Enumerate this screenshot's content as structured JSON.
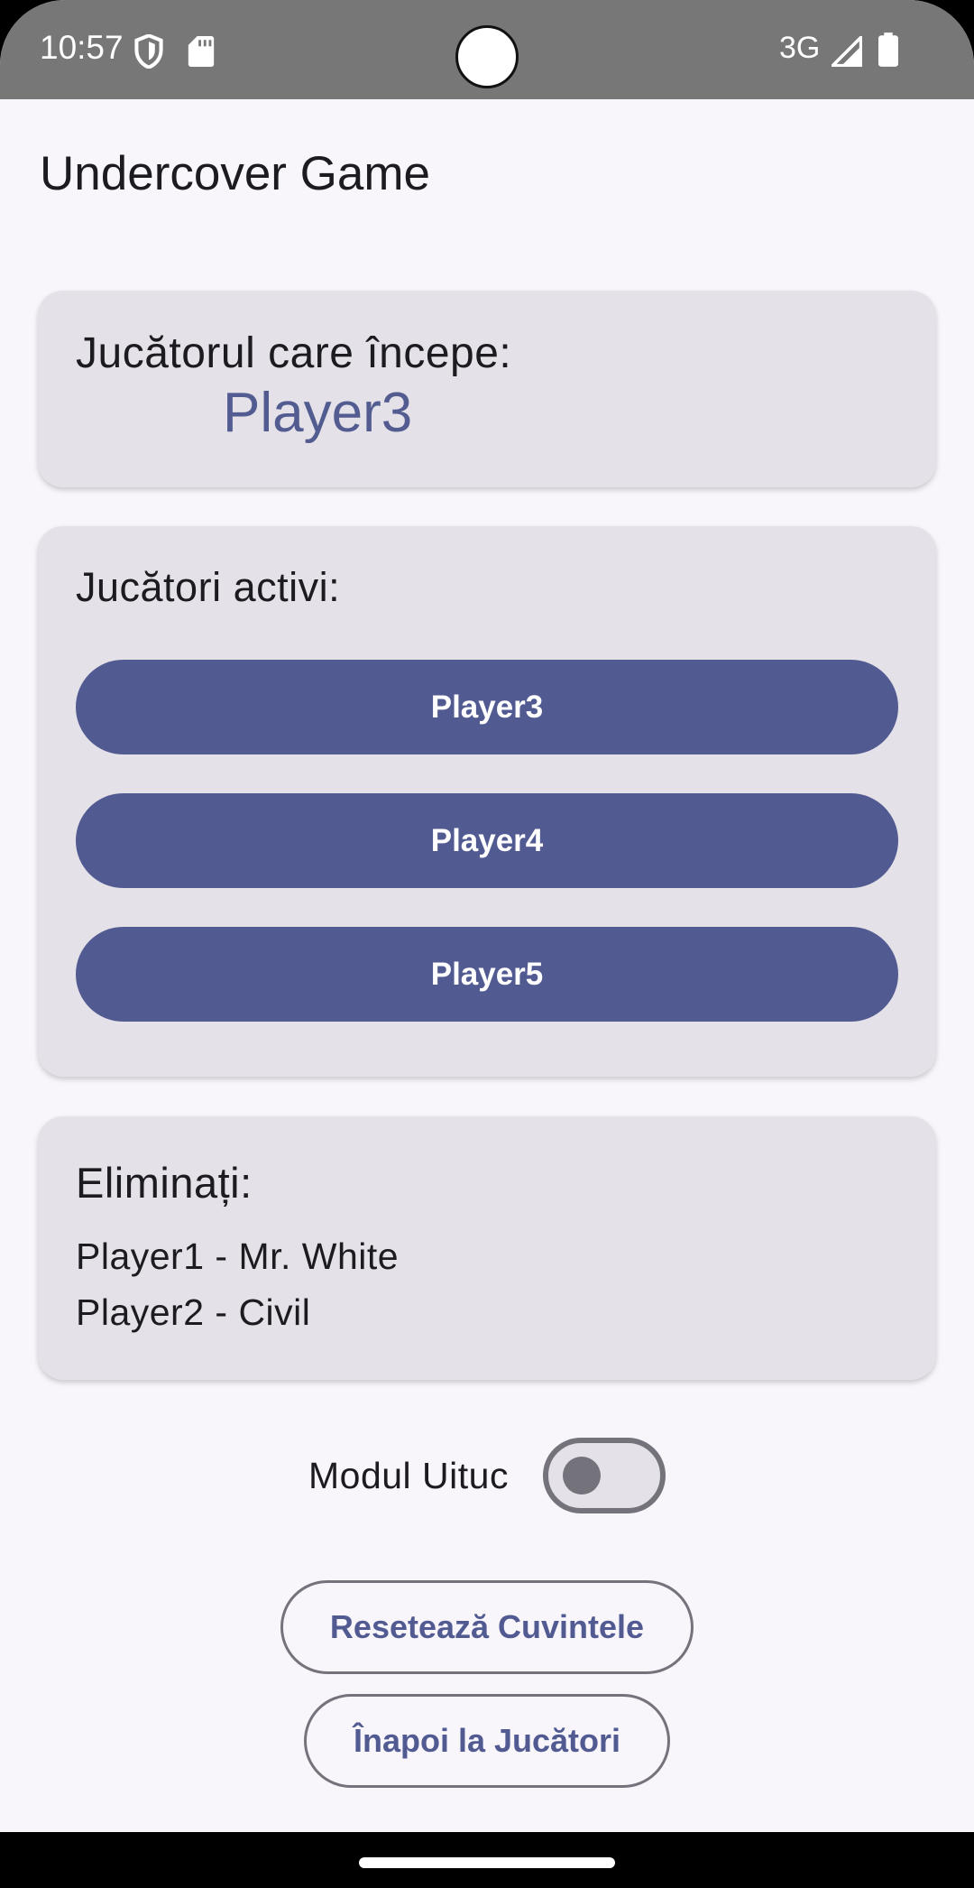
{
  "status_bar": {
    "time": "10:57",
    "network": "3G",
    "icons": [
      "shield-icon",
      "sd-card-icon",
      "cellular-signal-icon",
      "battery-icon"
    ]
  },
  "app": {
    "title": "Undercover Game"
  },
  "starting_player": {
    "label": "Jucătorul care începe:",
    "value": "Player3"
  },
  "active_players": {
    "label": "Jucători activi:",
    "players": [
      "Player3",
      "Player4",
      "Player5"
    ]
  },
  "eliminated": {
    "label": "Eliminați:",
    "items": [
      "Player1 - Mr. White",
      "Player2 - Civil"
    ]
  },
  "forgetful_mode": {
    "label": "Modul Uituc",
    "enabled": false
  },
  "actions": {
    "reset_words": "Resetează Cuvintele",
    "back_to_players": "Înapoi la Jucători"
  },
  "colors": {
    "primary": "#525a92",
    "card_bg": "#e4e1e8",
    "screen_bg": "#f8f5fb",
    "status_bar_bg": "#777777"
  }
}
